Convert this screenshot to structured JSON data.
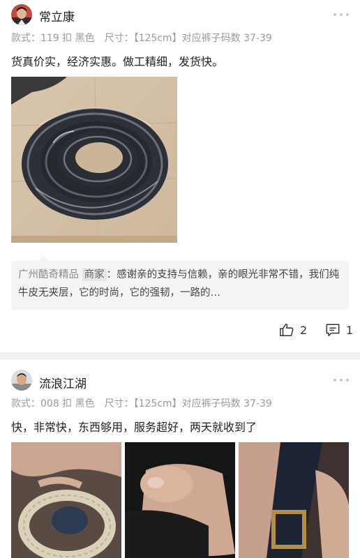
{
  "reviews": [
    {
      "username": "常立康",
      "spec": {
        "style_label": "款式：",
        "style_value": "119 扣 黑色",
        "size_label": "尺寸：",
        "size_value": "【125cm】对应裤子码数 37-39"
      },
      "content": "货真价实，经济实惠。做工精细，发货快。",
      "reply": {
        "shop": "广州酷奇精品",
        "tag": "商家",
        "colon": "：",
        "text": "感谢亲的支持与信赖，亲的眼光非常不错，我们纯牛皮无夹层，它的时尚，它的强韧，一路的…"
      },
      "likes": "2",
      "comments": "1"
    },
    {
      "username": "流浪江湖",
      "spec": {
        "style_label": "款式：",
        "style_value": "008 扣 黑色",
        "size_label": "尺寸：",
        "size_value": "【125cm】对应裤子码数 37-39"
      },
      "content": "快，非常快，东西够用，服务超好，两天就收到了"
    }
  ],
  "icons": {
    "like": "thumbs-up-icon",
    "comment": "comment-icon",
    "more": "more-dots-icon"
  },
  "colors": {
    "muted": "#9a9a9a",
    "reply_bg": "#f4f4f4",
    "separator": "#f2f2f2"
  }
}
